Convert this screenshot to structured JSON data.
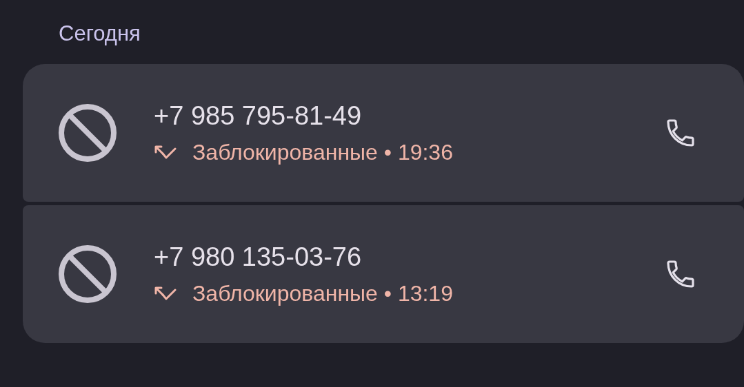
{
  "section_title": "Сегодня",
  "calls": [
    {
      "number": "+7 985 795-81-49",
      "detail": "Заблокированные • 19:36"
    },
    {
      "number": "+7 980 135-03-76",
      "detail": "Заблокированные • 13:19"
    }
  ]
}
